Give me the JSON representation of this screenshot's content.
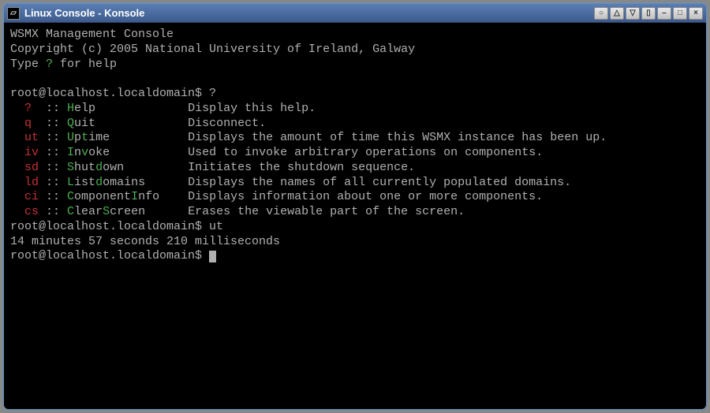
{
  "window": {
    "title": "Linux Console - Konsole"
  },
  "header": {
    "line1": "WSMX Management Console",
    "line2": "Copyright (c) 2005 National University of Ireland, Galway",
    "line3_pre": "Type ",
    "line3_mark": "?",
    "line3_post": " for help"
  },
  "prompt": "root@localhost.localdomain$ ",
  "first_command": "?",
  "help": [
    {
      "short": "?",
      "sep": "  :: ",
      "name_pre": "",
      "name_mark": "H",
      "name_post": "elp",
      "pad": "             ",
      "desc": "Display this help."
    },
    {
      "short": "q",
      "sep": "  :: ",
      "name_pre": "",
      "name_mark": "Q",
      "name_post": "uit",
      "pad": "             ",
      "desc": "Disconnect."
    },
    {
      "short": "ut",
      "sep": " :: ",
      "name_pre": "",
      "name_mark": "U",
      "name_mid": "p",
      "name_mark2": "t",
      "name_post": "ime",
      "pad": "           ",
      "desc": "Displays the amount of time this WSMX instance has been up."
    },
    {
      "short": "iv",
      "sep": " :: ",
      "name_pre": "",
      "name_mark": "I",
      "name_mid": "n",
      "name_mark2": "v",
      "name_post": "oke",
      "pad": "           ",
      "desc": "Used to invoke arbitrary operations on components."
    },
    {
      "short": "sd",
      "sep": " :: ",
      "name_pre": "",
      "name_mark": "S",
      "name_mid": "hut",
      "name_mark2": "d",
      "name_post": "own",
      "pad": "         ",
      "desc": "Initiates the shutdown sequence."
    },
    {
      "short": "ld",
      "sep": " :: ",
      "name_pre": "",
      "name_mark": "L",
      "name_mid": "ist",
      "name_mark2": "d",
      "name_post": "omains",
      "pad": "      ",
      "desc": "Displays the names of all currently populated domains."
    },
    {
      "short": "ci",
      "sep": " :: ",
      "name_pre": "",
      "name_mark": "C",
      "name_mid": "omponent",
      "name_mark2": "I",
      "name_post": "nfo",
      "pad": "    ",
      "desc": "Displays information about one or more components."
    },
    {
      "short": "cs",
      "sep": " :: ",
      "name_pre": "",
      "name_mark": "C",
      "name_mid": "lear",
      "name_mark2": "S",
      "name_post": "creen",
      "pad": "      ",
      "desc": "Erases the viewable part of the screen."
    }
  ],
  "second_command": "ut",
  "uptime_output": "14 minutes 57 seconds 210 milliseconds"
}
